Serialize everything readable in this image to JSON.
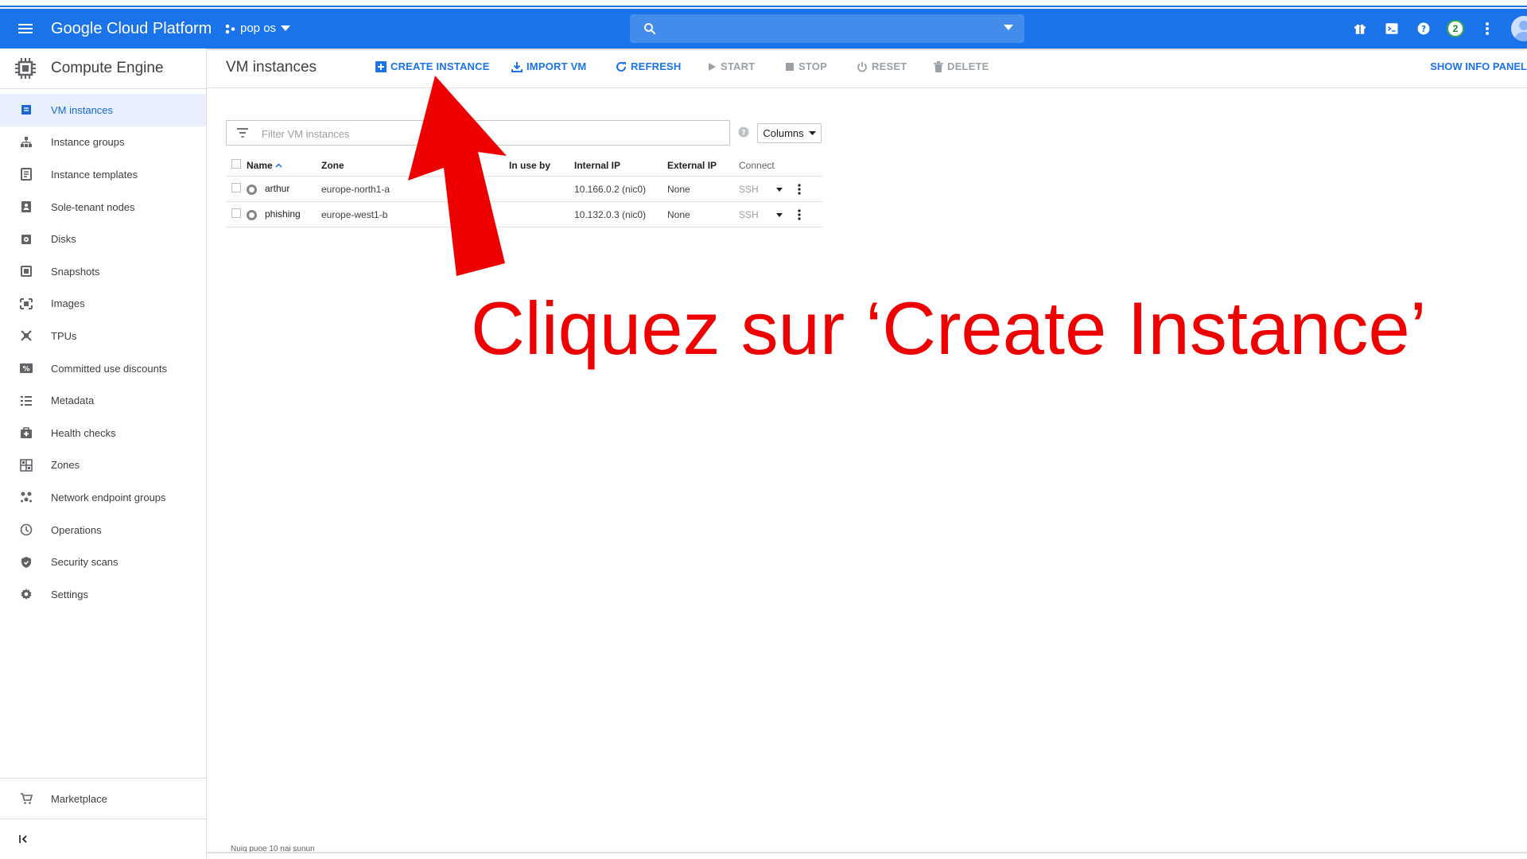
{
  "topbar": {
    "brand": "Google Cloud Platform",
    "project": "pop os",
    "search_placeholder": "",
    "notification_count": "2",
    "icons": [
      "gift-icon",
      "cloud-shell-icon",
      "help-icon",
      "notifications-icon",
      "more-vert-icon",
      "account-avatar-icon"
    ]
  },
  "sidebar": {
    "title": "Compute Engine",
    "items": [
      {
        "label": "VM instances",
        "icon": "vm-instances-icon",
        "active": true
      },
      {
        "label": "Instance groups",
        "icon": "instance-groups-icon"
      },
      {
        "label": "Instance templates",
        "icon": "instance-templates-icon"
      },
      {
        "label": "Sole-tenant nodes",
        "icon": "sole-tenant-icon"
      },
      {
        "label": "Disks",
        "icon": "disk-icon"
      },
      {
        "label": "Snapshots",
        "icon": "snapshot-icon"
      },
      {
        "label": "Images",
        "icon": "images-icon"
      },
      {
        "label": "TPUs",
        "icon": "tpu-icon"
      },
      {
        "label": "Committed use discounts",
        "icon": "discount-icon"
      },
      {
        "label": "Metadata",
        "icon": "metadata-icon"
      },
      {
        "label": "Health checks",
        "icon": "health-check-icon"
      },
      {
        "label": "Zones",
        "icon": "zones-icon"
      },
      {
        "label": "Network endpoint groups",
        "icon": "network-endpoint-icon"
      },
      {
        "label": "Operations",
        "icon": "clock-icon"
      },
      {
        "label": "Security scans",
        "icon": "shield-icon"
      },
      {
        "label": "Settings",
        "icon": "gear-icon"
      }
    ],
    "marketplace": "Marketplace"
  },
  "toolbar": {
    "page_title": "VM instances",
    "create": "CREATE INSTANCE",
    "import": "IMPORT VM",
    "refresh": "REFRESH",
    "start": "START",
    "stop": "STOP",
    "reset": "RESET",
    "delete": "DELETE",
    "info_panel": "SHOW INFO PANEL"
  },
  "filter": {
    "placeholder": "Filter VM instances",
    "columns_label": "Columns"
  },
  "table": {
    "headers": {
      "name": "Name",
      "zone": "Zone",
      "in_use_by": "In use by",
      "internal_ip": "Internal IP",
      "external_ip": "External IP",
      "connect": "Connect"
    },
    "rows": [
      {
        "name": "arthur",
        "zone": "europe-north1-a",
        "in_use_by": "",
        "internal_ip": "10.166.0.2 (nic0)",
        "external_ip": "None",
        "connect": "SSH"
      },
      {
        "name": "phishing",
        "zone": "europe-west1-b",
        "in_use_by": "",
        "internal_ip": "10.132.0.3 (nic0)",
        "external_ip": "None",
        "connect": "SSH"
      }
    ]
  },
  "footer": {
    "text": "Nuiq puoe 10 nai sunun"
  },
  "annotation": {
    "caption": "Cliquez sur ‘Create Instance’",
    "color": "#ee0000"
  },
  "colors": {
    "brand_blue": "#1a73e8",
    "active_bg": "#e8f0fe",
    "disabled": "#9aa0a6"
  }
}
